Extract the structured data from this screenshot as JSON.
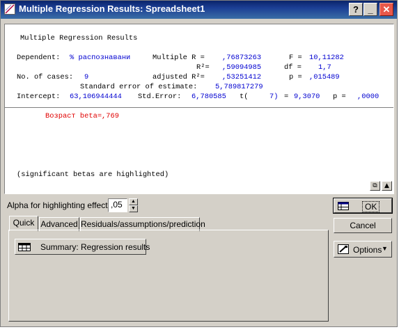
{
  "window": {
    "title": "Multiple Regression Results: Spreadsheet1"
  },
  "titlebar_buttons": {
    "help": "?",
    "minimize": "_",
    "close": "✕"
  },
  "results": {
    "heading": "Multiple Regression Results",
    "dependent_label": "Dependent:",
    "dependent_value": "% распознавани",
    "multiple_r_label": "Multiple R =",
    "multiple_r_value": ",76873263",
    "f_label": "F =",
    "f_value": "10,11282",
    "r2_label": "R²=",
    "r2_value": ",59094985",
    "df_label": "df =",
    "df_value": "1,7",
    "cases_label": "No. of cases:",
    "cases_value": "9",
    "adj_r2_label": "adjusted R²=",
    "adj_r2_value": ",53251412",
    "p_label": "p =",
    "p_value": ",015489",
    "std_err_est_label": "Standard error of estimate:",
    "std_err_est_value": "5,789817279",
    "intercept_label": "Intercept:",
    "intercept_value": "63,106944444",
    "stderror_label": "Std.Error:",
    "stderror_value": "6,780585",
    "t_label": "t(",
    "t_df": "7)",
    "t_eq": "=",
    "t_value": "9,3070",
    "p2_label": "p =",
    "p2_value": ",0000",
    "beta_line": "Возраст beta=,769",
    "footnote": "(significant betas are highlighted)"
  },
  "alpha": {
    "label": "Alpha for highlighting effects:",
    "value": ",05"
  },
  "tabs": [
    {
      "label": "Quick"
    },
    {
      "label": "Advanced"
    },
    {
      "label": "Residuals/assumptions/prediction"
    }
  ],
  "summary_button": {
    "label": "Summary:  Regression results"
  },
  "side_buttons": {
    "ok": "OK",
    "cancel": "Cancel",
    "options": "Options"
  }
}
